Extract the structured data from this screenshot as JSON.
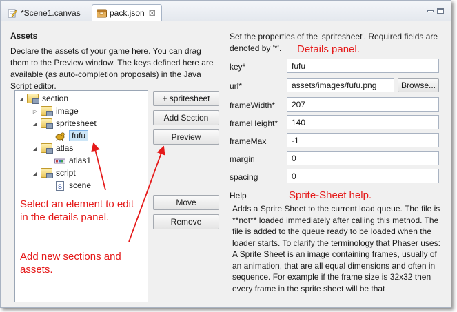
{
  "tabs": [
    {
      "label": "*Scene1.canvas",
      "icon": "canvas-edit-icon"
    },
    {
      "label": "pack.json",
      "icon": "json-file-icon",
      "close": "☒"
    }
  ],
  "assets": {
    "title": "Assets",
    "description": "Declare the assets of your game here. You can drag them to the Preview window. The keys defined here are available (as auto-completion proposals) in the Java Script editor."
  },
  "tree": {
    "root": "section",
    "items": [
      {
        "label": "image",
        "icon": "folder-icon"
      },
      {
        "label": "spritesheet",
        "icon": "folder-icon"
      },
      {
        "label": "fufu",
        "icon": "sprite-icon",
        "selected": true
      },
      {
        "label": "atlas",
        "icon": "folder-icon"
      },
      {
        "label": "atlas1",
        "icon": "atlas-icon"
      },
      {
        "label": "script",
        "icon": "folder-icon"
      },
      {
        "label": "scene",
        "icon": "script-icon"
      }
    ]
  },
  "buttons": {
    "add_spritesheet": "+ spritesheet",
    "add_section": "Add Section",
    "preview": "Preview",
    "move": "Move",
    "remove": "Remove"
  },
  "details": {
    "intro": "Set the properties of the 'spritesheet'. Required fields are denoted by '*'.",
    "browse": "Browse...",
    "fields": [
      {
        "label": "key*",
        "value": "fufu"
      },
      {
        "label": "url*",
        "value": "assets/images/fufu.png"
      },
      {
        "label": "frameWidth*",
        "value": "207"
      },
      {
        "label": "frameHeight*",
        "value": "140"
      },
      {
        "label": "frameMax",
        "value": "-1"
      },
      {
        "label": "margin",
        "value": "0"
      },
      {
        "label": "spacing",
        "value": "0"
      }
    ],
    "help_label": "Help",
    "help_text": "Adds a Sprite Sheet to the current load queue. The file is **not** loaded immediately after calling this method. The file is added to the queue ready to be loaded when the loader starts. To clarify the terminology that Phaser uses: A Sprite Sheet is an image containing frames, usually of an animation, that are all equal dimensions and often in sequence. For example if the frame size is 32x32 then every frame in the sprite sheet will be that"
  },
  "annotations": {
    "details_panel": "Details panel.",
    "sprite_sheet_help": "Sprite-Sheet help.",
    "select_element": "Select an element to edit in the details panel.",
    "add_sections": "Add new sections and assets.",
    "color": "#e51a1a"
  }
}
